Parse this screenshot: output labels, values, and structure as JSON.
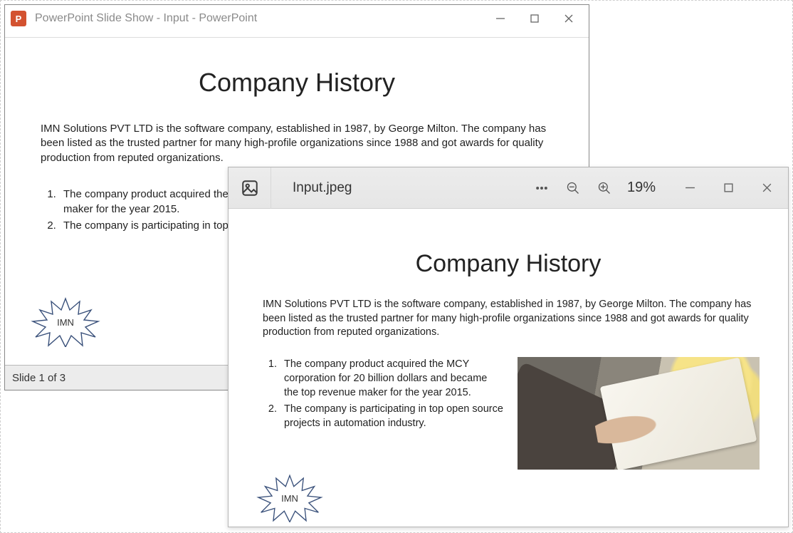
{
  "powerpoint": {
    "title": "PowerPoint Slide Show  -  Input - PowerPoint",
    "logo_letter": "P",
    "status": "Slide 1 of 3"
  },
  "slide": {
    "heading": "Company History",
    "paragraph": "IMN Solutions PVT LTD is the software company, established in 1987, by George Milton. The company has been listed as the trusted partner for many high-profile organizations since 1988 and got awards for quality production from reputed organizations.",
    "list": [
      "The company product acquired the MCY corporation for 20 billion dollars and became the top revenue maker for the year 2015.",
      "The company is participating in top open source projects in automation industry."
    ],
    "badge": "IMN"
  },
  "viewer": {
    "filename": "Input.jpeg",
    "zoom": "19%"
  }
}
